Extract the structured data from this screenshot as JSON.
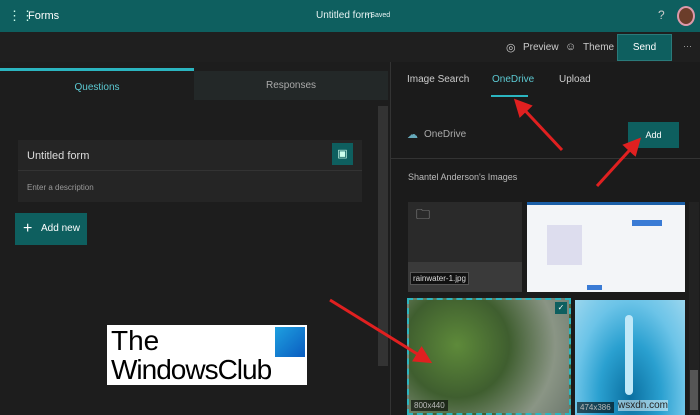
{
  "topbar": {
    "app": "Forms",
    "title": "Untitled form",
    "status": "- Saved",
    "help": "?"
  },
  "toolbar": {
    "preview": "Preview",
    "theme": "Theme",
    "send": "Send",
    "more": "···"
  },
  "left": {
    "tabs": [
      "Questions",
      "Responses"
    ],
    "form_title": "Untitled form",
    "description_placeholder": "Enter a description",
    "add_new": "Add new"
  },
  "right": {
    "tabs": [
      "Image Search",
      "OneDrive",
      "Upload"
    ],
    "source": "OneDrive",
    "add": "Add",
    "section": "Shantel Anderson's Images",
    "tiles": [
      {
        "tooltip": "rainwater-1.jpg"
      },
      {
        "size": ""
      },
      {
        "size": "800x440",
        "selected": true
      },
      {
        "size": "474x386"
      }
    ]
  },
  "logo": {
    "line1": "The",
    "line2": "WindowsClub"
  },
  "watermark": "wsxdn.com",
  "colors": {
    "teal": "#0e5f5f",
    "accent": "#2bb5c0",
    "arrow": "#e02020"
  }
}
